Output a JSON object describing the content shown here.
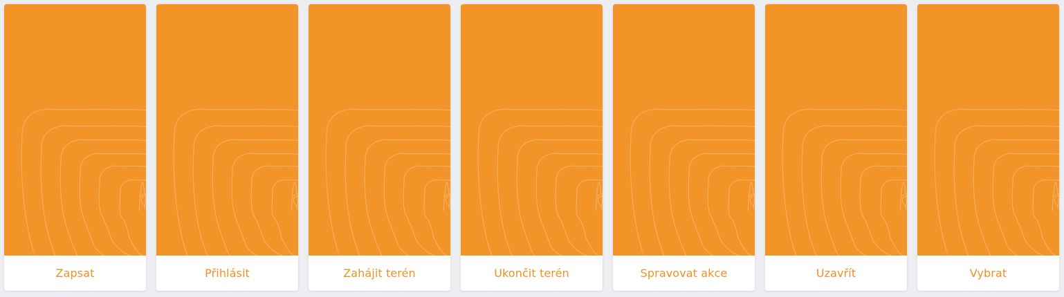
{
  "colors": {
    "accent": "#f29428",
    "label_text": "#ef9125",
    "background": "#eceef2"
  },
  "cards": [
    {
      "label": "Zapsat",
      "pattern": "contour-lines"
    },
    {
      "label": "Přihlásit",
      "pattern": "contour-lines"
    },
    {
      "label": "Zahájit terén",
      "pattern": "contour-lines"
    },
    {
      "label": "Ukončit terén",
      "pattern": "contour-lines"
    },
    {
      "label": "Spravovat akce",
      "pattern": "contour-lines"
    },
    {
      "label": "Uzavřít",
      "pattern": "contour-lines"
    },
    {
      "label": "Vybrat",
      "pattern": "contour-lines"
    }
  ]
}
